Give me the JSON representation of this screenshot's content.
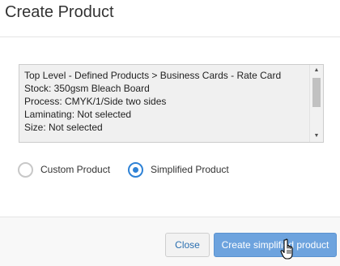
{
  "dialog": {
    "title": "Create Product"
  },
  "summary": {
    "lines": [
      "Top Level - Defined Products > Business Cards - Rate Card",
      "Stock: 350gsm Bleach Board",
      "Process: CMYK/1/Side two sides",
      "Laminating: Not selected",
      "Size: Not selected"
    ],
    "scroll_up_icon": "triangle-up",
    "scroll_down_icon": "triangle-down"
  },
  "product_type": {
    "options": [
      {
        "label": "Custom Product",
        "checked": false
      },
      {
        "label": "Simplified Product",
        "checked": true
      }
    ],
    "selected": "Simplified Product"
  },
  "footer": {
    "close_label": "Close",
    "create_label": "Create simplified product"
  },
  "colors": {
    "primary": "#6da3de",
    "radio_checked": "#2e82d6",
    "link": "#2a6fb0"
  },
  "cursor": {
    "icon": "hand-pointer-cursor"
  }
}
